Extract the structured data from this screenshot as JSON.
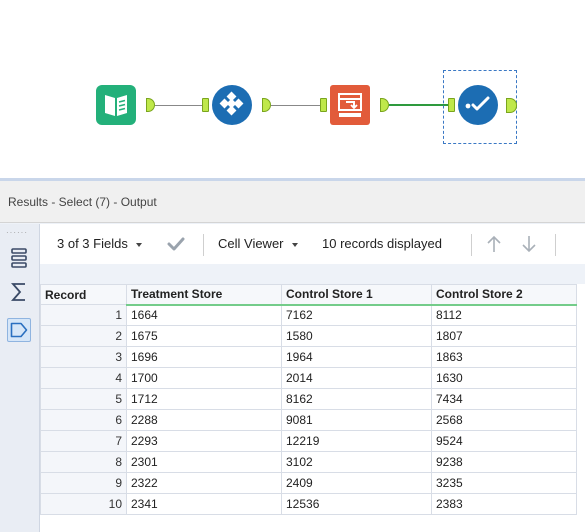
{
  "results": {
    "title": "Results - Select (7) - Output",
    "toolbar": {
      "fields_label": "3 of 3 Fields",
      "cell_viewer_label": "Cell Viewer",
      "records_displayed": "10 records displayed"
    },
    "table": {
      "columns": [
        "Record",
        "Treatment Store",
        "Control Store 1",
        "Control Store 2"
      ],
      "rows": [
        [
          "1",
          "1664",
          "7162",
          "8112"
        ],
        [
          "2",
          "1675",
          "1580",
          "1807"
        ],
        [
          "3",
          "1696",
          "1964",
          "1863"
        ],
        [
          "4",
          "1700",
          "2014",
          "1630"
        ],
        [
          "5",
          "1712",
          "8162",
          "7434"
        ],
        [
          "6",
          "2288",
          "9081",
          "2568"
        ],
        [
          "7",
          "2293",
          "12219",
          "9524"
        ],
        [
          "8",
          "2301",
          "3102",
          "9238"
        ],
        [
          "9",
          "2322",
          "2409",
          "3235"
        ],
        [
          "10",
          "2341",
          "12536",
          "2383"
        ]
      ]
    }
  },
  "icons": {
    "workflow": [
      "input-data-icon",
      "create-samples-icon",
      "select-icon",
      "browse-icon"
    ],
    "toolbar": [
      "checkmark-icon",
      "arrow-up-icon",
      "arrow-down-icon"
    ],
    "rail": [
      "grid-view-icon",
      "summary-icon",
      "metadata-tag-icon"
    ]
  },
  "colors": {
    "input_tool": "#23b07a",
    "create_samples_tool": "#1c6db3",
    "select_tool": "#e25b3a",
    "browse_tool": "#1c6db3",
    "anchor": "#bfe84a",
    "active_connection": "#2e9a3e",
    "field_header_underline": "#74cc8a"
  }
}
